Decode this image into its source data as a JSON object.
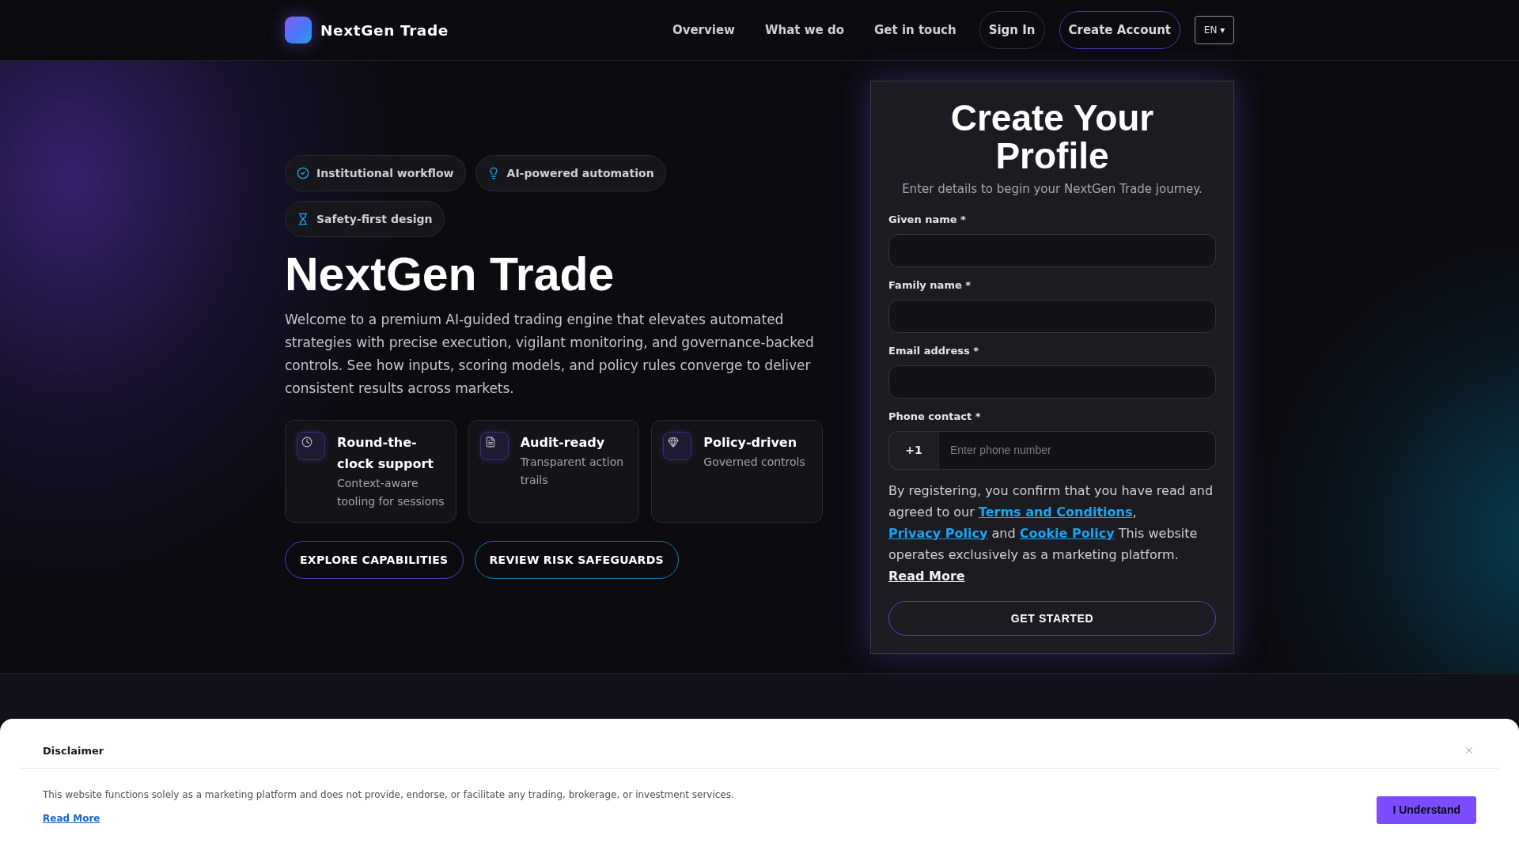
{
  "header": {
    "brand": "NextGen Trade",
    "nav": [
      {
        "label": "Overview"
      },
      {
        "label": "What we do"
      },
      {
        "label": "Get in touch"
      }
    ],
    "actions": [
      {
        "label": "Sign In",
        "kind": "ghost"
      },
      {
        "label": "Create Account",
        "kind": "accent"
      }
    ],
    "language": "EN ▾"
  },
  "hero": {
    "badges": [
      "Institutional workflow",
      "AI-powered automation",
      "Safety-first design"
    ],
    "title": "NextGen Trade",
    "description": "Welcome to a premium AI-guided trading engine that elevates automated strategies with precise execution, vigilant monitoring, and governance-backed controls. See how inputs, scoring models, and policy rules converge to deliver consistent results across markets.",
    "features": [
      {
        "title": "Round-the-clock support",
        "description": "Context-aware tooling for sessions"
      },
      {
        "title": "Audit-ready",
        "description": "Transparent action trails"
      },
      {
        "title": "Policy-driven",
        "description": "Governed controls"
      }
    ],
    "buttons": [
      {
        "label": "EXPLORE CAPABILITIES",
        "kind": "primary"
      },
      {
        "label": "REVIEW RISK SAFEGUARDS",
        "kind": "secondary"
      }
    ]
  },
  "form": {
    "title": "Create Your Profile",
    "subtitle": "Enter details to begin your NextGen Trade journey.",
    "fields": [
      {
        "label": "Given name *",
        "kind": "text"
      },
      {
        "label": "Family name *",
        "kind": "text"
      },
      {
        "label": "Email address *",
        "kind": "email"
      },
      {
        "label": "Phone contact *",
        "kind": "phone",
        "prefix": "+1",
        "placeholder": "Enter phone number"
      }
    ],
    "consent": [
      {
        "kind": "text",
        "text": "By registering, you confirm that you have read and agreed to our "
      },
      {
        "kind": "link",
        "text": "Terms and Conditions"
      },
      {
        "kind": "text",
        "text": ", "
      },
      {
        "kind": "link",
        "text": "Privacy Policy"
      },
      {
        "kind": "text",
        "text": " and "
      },
      {
        "kind": "link",
        "text": "Cookie Policy"
      },
      {
        "kind": "text",
        "text": " This website operates exclusively as a marketing platform. "
      },
      {
        "kind": "more",
        "text": "Read More"
      }
    ],
    "submit": "GET STARTED"
  },
  "disclaimer": {
    "title": "Disclaimer",
    "text": "This website functions solely as a marketing platform and does not provide, endorse, or facilitate any trading, brokerage, or investment services.",
    "link": "Read More",
    "button": "I Understand"
  }
}
